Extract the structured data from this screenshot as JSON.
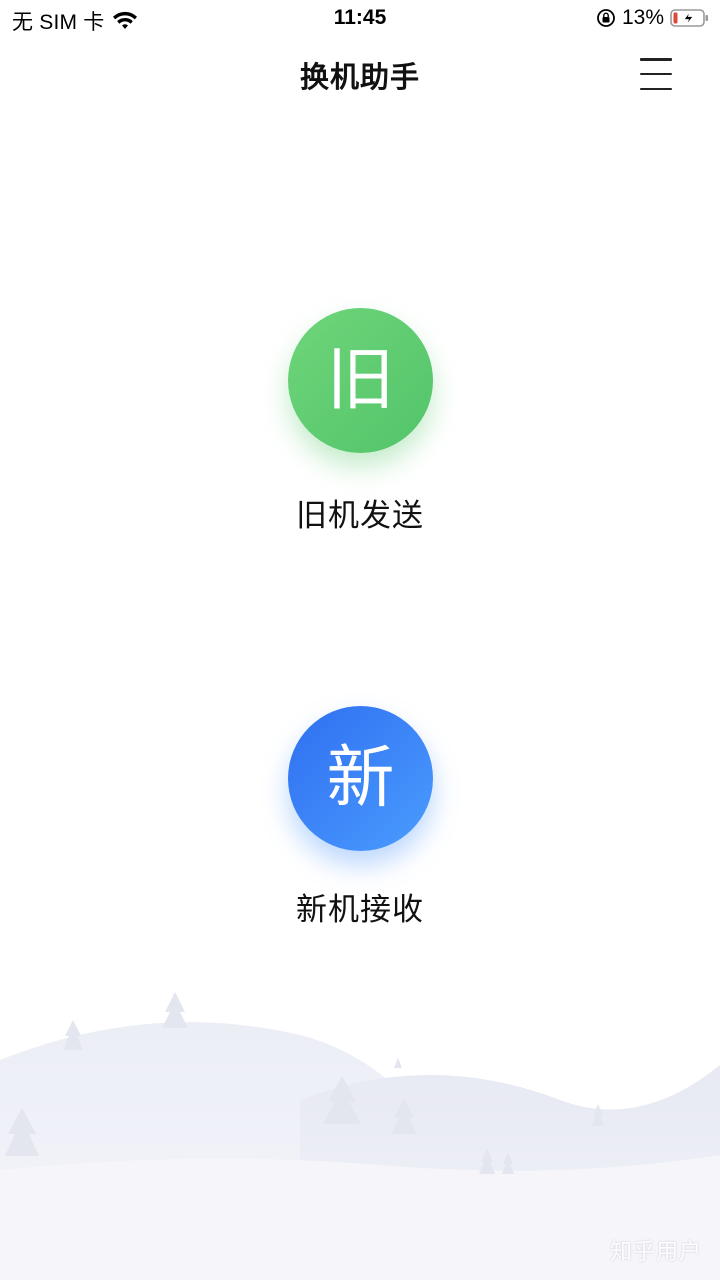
{
  "status_bar": {
    "carrier": "无 SIM 卡",
    "time": "11:45",
    "battery": "13%",
    "icons": [
      "wifi-icon",
      "rotation-lock-icon",
      "battery-charging-icon"
    ]
  },
  "nav": {
    "title": "换机助手",
    "menu_icon": "menu-icon"
  },
  "options": {
    "old": {
      "glyph": "旧",
      "label": "旧机发送",
      "color": "#5ccb72"
    },
    "new": {
      "glyph": "新",
      "label": "新机接收",
      "color": "#3a86f5"
    }
  },
  "watermark": "知乎用户"
}
